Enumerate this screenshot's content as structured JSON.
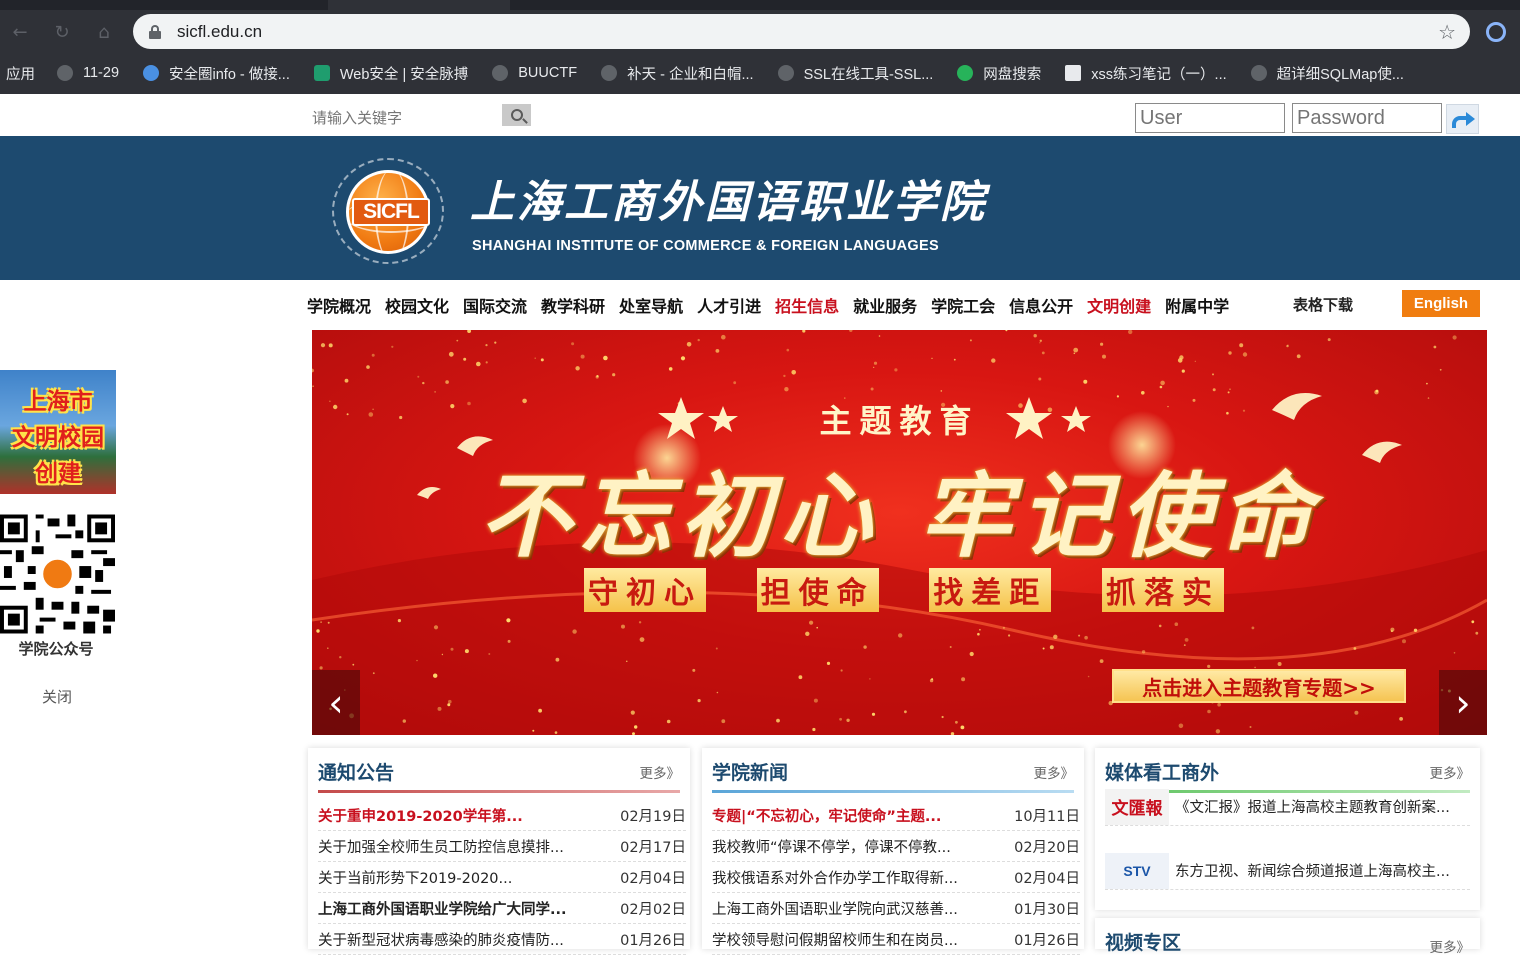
{
  "browser": {
    "url": "sicfl.edu.cn",
    "bookmarks": [
      {
        "label": "应用"
      },
      {
        "label": "11-29"
      },
      {
        "label": "安全圈info - 做接..."
      },
      {
        "label": "Web安全 | 安全脉搏"
      },
      {
        "label": "BUUCTF"
      },
      {
        "label": "补天 - 企业和白帽..."
      },
      {
        "label": "SSL在线工具-SSL..."
      },
      {
        "label": "网盘搜索"
      },
      {
        "label": "xss练习笔记（一）..."
      },
      {
        "label": "超详细SQLMap使..."
      }
    ]
  },
  "topbar": {
    "search_placeholder": "请输入关键字",
    "user_placeholder": "User",
    "password_placeholder": "Password"
  },
  "header": {
    "logo_mark": "SICFL",
    "name_cn": "上海工商外国语职业学院",
    "name_en": "SHANGHAI INSTITUTE OF COMMERCE & FOREIGN LANGUAGES"
  },
  "nav": {
    "items": [
      "学院概况",
      "校园文化",
      "国际交流",
      "教学科研",
      "处室导航",
      "人才引进",
      "招生信息",
      "就业服务",
      "学院工会",
      "信息公开",
      "文明创建",
      "附属中学"
    ],
    "extra": "表格下载",
    "english": "English"
  },
  "float": {
    "banner_lines": [
      "上海市",
      "文明校园",
      "创建"
    ],
    "qr_caption": "学院公众号",
    "close": "关闭"
  },
  "hero": {
    "theme": "主题教育",
    "title": "不忘初心 牢记使命",
    "slogans": [
      "守初心",
      "担使命",
      "找差距",
      "抓落实"
    ],
    "cta": "点击进入主题教育专题>>",
    "prev": "‹",
    "next": "›"
  },
  "notices": {
    "title": "通知公告",
    "more": "更多》",
    "items": [
      {
        "title": "关于重申2019-2020学年第...",
        "date": "02月19日"
      },
      {
        "title": "关于加强全校师生员工防控信息摸排...",
        "date": "02月17日"
      },
      {
        "title": "关于当前形势下2019-2020...",
        "date": "02月04日"
      },
      {
        "title": "上海工商外国语职业学院给广大同学...",
        "date": "02月02日"
      },
      {
        "title": "关于新型冠状病毒感染的肺炎疫情防...",
        "date": "01月26日"
      }
    ]
  },
  "news": {
    "title": "学院新闻",
    "more": "更多》",
    "items": [
      {
        "title": "专题|“不忘初心，牢记使命”主题...",
        "date": "10月11日"
      },
      {
        "title": "我校教师“停课不停学，停课不停教...",
        "date": "02月20日"
      },
      {
        "title": "我校俄语系对外合作办学工作取得新...",
        "date": "02月04日"
      },
      {
        "title": "上海工商外国语职业学院向武汉慈善...",
        "date": "01月30日"
      },
      {
        "title": "学校领导慰问假期留校师生和在岗员...",
        "date": "01月26日"
      }
    ]
  },
  "media": {
    "title": "媒体看工商外",
    "more": "更多》",
    "items": [
      {
        "logo": "文匯報",
        "text": "《文汇报》报道上海高校主题教育创新案..."
      },
      {
        "logo": "STV",
        "text": "东方卫视、新闻综合频道报道上海高校主..."
      }
    ]
  },
  "video": {
    "title": "视频专区",
    "more": "更多》"
  },
  "colors": {
    "header_band": "#1d4a6f",
    "accent_red": "#c8101e",
    "english_orange": "#f07d10"
  }
}
